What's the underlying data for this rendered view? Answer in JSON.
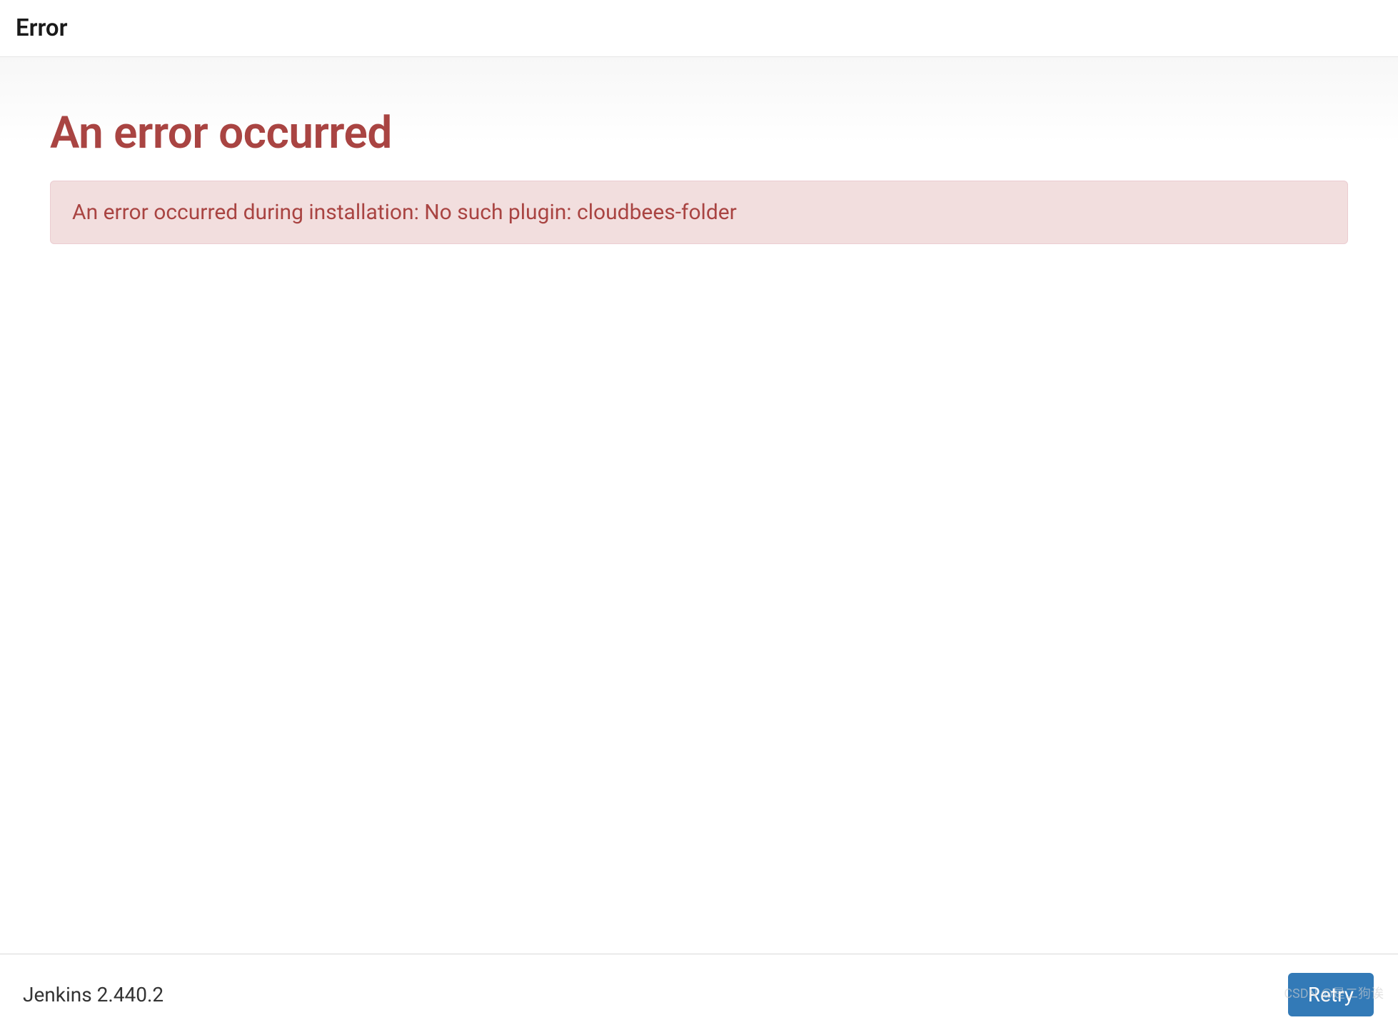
{
  "header": {
    "title": "Error"
  },
  "main": {
    "heading": "An error occurred",
    "alert_message": "An error occurred during installation: No such plugin: cloudbees-folder"
  },
  "footer": {
    "version_text": "Jenkins 2.440.2",
    "retry_label": "Retry"
  },
  "watermark": "CSDN @是二狗诶",
  "colors": {
    "error_text": "#a94442",
    "error_bg": "#f2dede",
    "error_border": "#ebccd1",
    "button_bg": "#337ab7"
  }
}
